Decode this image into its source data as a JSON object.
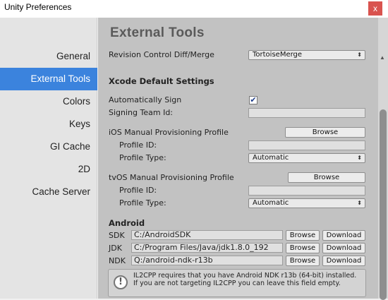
{
  "window": {
    "title": "Unity Preferences",
    "close_label": "x"
  },
  "sidebar": {
    "items": [
      {
        "label": "General"
      },
      {
        "label": "External Tools"
      },
      {
        "label": "Colors"
      },
      {
        "label": "Keys"
      },
      {
        "label": "GI Cache"
      },
      {
        "label": "2D"
      },
      {
        "label": "Cache Server"
      }
    ],
    "active_index": 1
  },
  "main": {
    "heading": "External Tools",
    "revision_control": {
      "label": "Revision Control Diff/Merge",
      "value": "TortoiseMerge"
    },
    "xcode": {
      "section_title": "Xcode Default Settings",
      "auto_sign_label": "Automatically Sign",
      "auto_sign_checked": "✔",
      "signing_team_label": "Signing Team Id:",
      "signing_team_value": "",
      "ios_label": "iOS Manual Provisioning Profile",
      "ios_browse": "Browse",
      "ios_profile_id_label": "Profile ID:",
      "ios_profile_id_value": "",
      "ios_profile_type_label": "Profile Type:",
      "ios_profile_type_value": "Automatic",
      "tvos_label": "tvOS Manual Provisioning Profile",
      "tvos_browse": "Browse",
      "tvos_profile_id_label": "Profile ID:",
      "tvos_profile_id_value": "",
      "tvos_profile_type_label": "Profile Type:",
      "tvos_profile_type_value": "Automatic"
    },
    "android": {
      "section_title": "Android",
      "sdk_label": "SDK",
      "sdk_value": "C:/AndroidSDK",
      "jdk_label": "JDK",
      "jdk_value": "C:/Program Files/Java/jdk1.8.0_192",
      "ndk_label": "NDK",
      "ndk_value": "Q:/android-ndk-r13b",
      "browse_label": "Browse",
      "download_label": "Download",
      "help_line1": "IL2CPP requires that you have Android NDK r13b (64-bit) installed.",
      "help_line2": "If you are not targeting IL2CPP you can leave this field empty."
    }
  },
  "colors": {
    "accent": "#3b83dd",
    "close": "#d9534f",
    "panel": "#c2c2c2"
  }
}
